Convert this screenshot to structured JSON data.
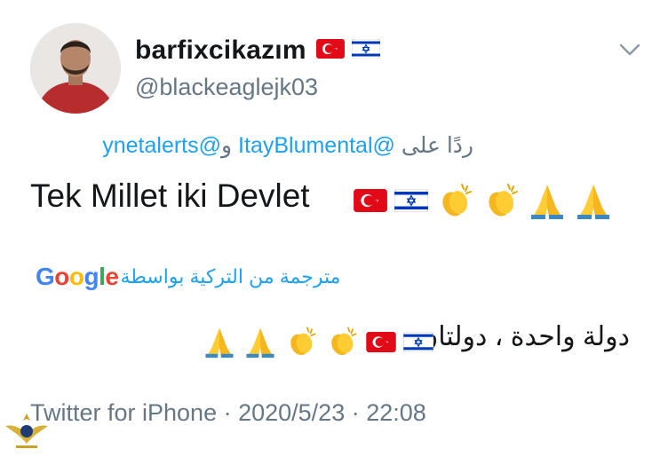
{
  "tweet": {
    "display_name": "barfixcikazım",
    "handle": "@blackeaglejk03",
    "name_flags": [
      "turkey-flag",
      "israel-flag"
    ],
    "reply": {
      "prefix": "ردًا على",
      "mention_1": "@ItayBlumental",
      "joiner": "و",
      "mention_2": "@ynetalerts"
    },
    "text": "Tek Millet iki Devlet",
    "text_emojis": [
      "turkey-flag",
      "israel-flag",
      "clapping-hands",
      "clapping-hands",
      "folded-hands",
      "folded-hands"
    ],
    "translation": {
      "label": "مترجمة من التركية بواسطة",
      "provider": "Google",
      "text": "دولة واحدة ، دولتان",
      "emojis": [
        "folded-hands",
        "folded-hands",
        "clapping-hands",
        "clapping-hands",
        "turkey-flag",
        "israel-flag"
      ]
    },
    "meta": {
      "source": "Twitter for iPhone",
      "separator": " · ",
      "date": "2020/5/23",
      "time": "22:08"
    }
  },
  "colors": {
    "link": "#1da1f2",
    "secondary_text": "#657786",
    "primary_text": "#14171a",
    "turkey_red": "#e30a17",
    "israel_blue": "#0038b8"
  },
  "icons": {
    "more_menu": "chevron-down-icon",
    "watermark": "eagle-emblem"
  }
}
